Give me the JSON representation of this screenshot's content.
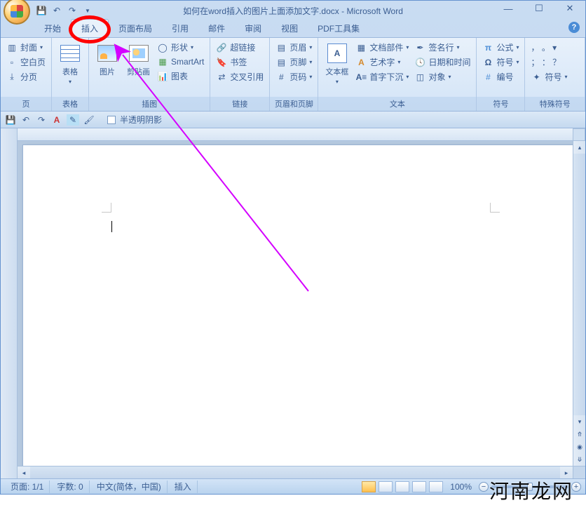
{
  "title": "如何在word插入的图片上面添加文字.docx - Microsoft Word",
  "tabs": {
    "home": "开始",
    "insert": "插入",
    "layout": "页面布局",
    "ref": "引用",
    "mail": "邮件",
    "review": "审阅",
    "view": "视图",
    "pdf": "PDF工具集"
  },
  "groups": {
    "pages": {
      "label": "页",
      "cover": "封面",
      "blank": "空白页",
      "break": "分页"
    },
    "tables": {
      "label": "表格",
      "table": "表格"
    },
    "illus": {
      "label": "插图",
      "picture": "图片",
      "clipart": "剪贴画",
      "shapes": "形状",
      "smartart": "SmartArt",
      "chart": "图表"
    },
    "links": {
      "label": "链接",
      "hyperlink": "超链接",
      "bookmark": "书签",
      "crossref": "交叉引用"
    },
    "headerfooter": {
      "label": "页眉和页脚",
      "header": "页眉",
      "footer": "页脚",
      "pagenum": "页码"
    },
    "text": {
      "label": "文本",
      "textbox": "文本框",
      "quickparts": "文档部件",
      "wordart": "艺术字",
      "dropcap": "首字下沉",
      "sigline": "签名行",
      "datetime": "日期和时间",
      "object": "对象"
    },
    "symbols": {
      "label": "符号",
      "equation": "公式",
      "symbol": "符号",
      "number": "编号"
    },
    "special": {
      "label": "特殊符号",
      "symbol2": "符号"
    }
  },
  "toolbar2": {
    "translucent": "半透明阴影"
  },
  "status": {
    "page": "页面: 1/1",
    "words": "字数: 0",
    "lang": "中文(简体，中国)",
    "mode": "插入",
    "zoom": "100%"
  },
  "watermark": "河南龙网"
}
